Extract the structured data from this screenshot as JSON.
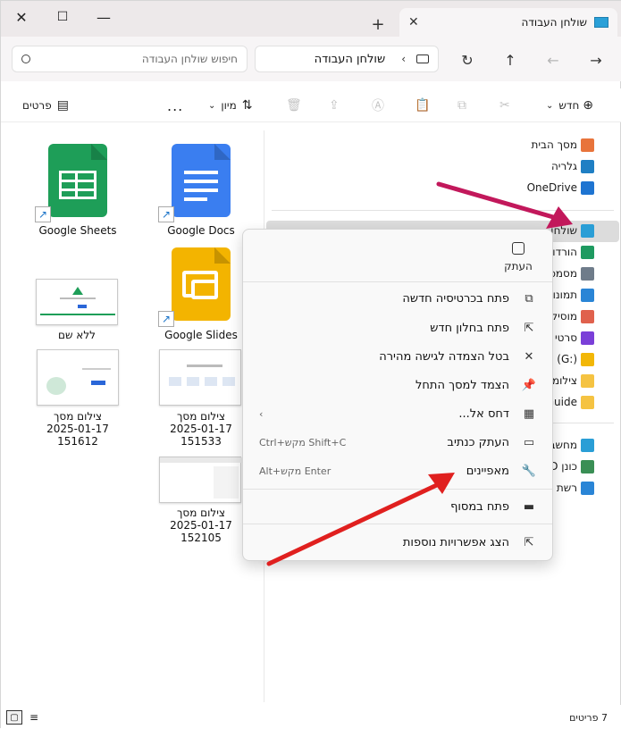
{
  "window": {
    "tab_title": "שולחן העבודה",
    "new_tab": "+",
    "close": "✕",
    "restore": "☐",
    "minimize": "—"
  },
  "address": {
    "crumb": "שולחן העבודה",
    "search_placeholder": "חיפוש שולחן העבודה"
  },
  "commands": {
    "new_label": "חדש",
    "sort_label": "מיון",
    "more_label": "...",
    "details_label": "פרטים"
  },
  "sidebar": {
    "items": [
      {
        "label": "מסך הבית",
        "icon": "home-icon",
        "color": "#e8743b"
      },
      {
        "label": "גלריה",
        "icon": "gallery-icon",
        "color": "#1f7fc4"
      },
      {
        "label": "OneDrive",
        "icon": "onedrive-cloud-icon",
        "color": "#1e74d1"
      },
      {
        "label": "שולחן",
        "icon": "desktop-icon",
        "color": "#2a9ed6"
      },
      {
        "label": "הורדו",
        "icon": "downloads-icon",
        "color": "#1e9a60"
      },
      {
        "label": "מסמכ",
        "icon": "documents-icon",
        "color": "#6f7c8a"
      },
      {
        "label": "תמונו",
        "icon": "pictures-icon",
        "color": "#2a85d6"
      },
      {
        "label": "מוסיק",
        "icon": "music-icon",
        "color": "#e0614d"
      },
      {
        "label": "סרטי",
        "icon": "videos-icon",
        "color": "#7a3fd8"
      },
      {
        "label": "e (G:)",
        "icon": "google-drive-icon",
        "color": "#f2b707"
      },
      {
        "label": "צילומ",
        "icon": "folder-icon",
        "color": "#f5c342"
      },
      {
        "label": "Guide",
        "icon": "folder-icon",
        "color": "#f5c342"
      },
      {
        "label": "מחשב",
        "icon": "this-pc-icon",
        "color": "#2a9ed6"
      },
      {
        "label": "כונן D",
        "icon": "drive-icon",
        "color": "#3a8f55"
      },
      {
        "label": "רשת",
        "icon": "network-icon",
        "color": "#2a85d6"
      }
    ]
  },
  "files": [
    {
      "label": "Google Sheets",
      "icon": "google-sheets-icon",
      "color": "#1e9e58"
    },
    {
      "label": "Google Docs",
      "icon": "google-docs-icon",
      "color": "#3a7ef0"
    },
    {
      "label": "ללא שם",
      "icon": "screenshot-thumbnail"
    },
    {
      "label": "Google Slides",
      "icon": "google-slides-icon",
      "color": "#f3b400"
    },
    {
      "label_lines": [
        "צילום מסך",
        "2025-01-17",
        "151612"
      ],
      "icon": "screenshot-thumbnail"
    },
    {
      "label_lines": [
        "צילום מסך",
        "2025-01-17",
        "151533"
      ],
      "icon": "screenshot-thumbnail"
    },
    {
      "label_lines": [
        "צילום מסך",
        "2025-01-17",
        "152105"
      ],
      "icon": "screenshot-thumbnail"
    }
  ],
  "context_menu": {
    "copy_label": "העתק",
    "items": [
      {
        "label": "פתח בכרטיסיה חדשה",
        "icon": "open-new-tab-icon",
        "shortcut": ""
      },
      {
        "label": "פתח בחלון חדש",
        "icon": "open-new-window-icon",
        "shortcut": ""
      },
      {
        "label": "בטל הצמדה לגישה מהירה",
        "icon": "unpin-icon",
        "shortcut": ""
      },
      {
        "label": "הצמד למסך התחל",
        "icon": "pin-icon",
        "shortcut": ""
      },
      {
        "label": "דחס אל...",
        "icon": "zip-icon",
        "shortcut": "‹"
      },
      {
        "label": "העתק כנתיב",
        "icon": "copy-path-icon",
        "shortcut": "Ctrl+מקש Shift+C"
      },
      {
        "label": "מאפיינים",
        "icon": "wrench-icon",
        "shortcut": "Alt+מקש Enter"
      },
      {
        "label": "פתח במסוף",
        "icon": "terminal-icon",
        "shortcut": ""
      },
      {
        "label": "הצג אפשרויות נוספות",
        "icon": "more-options-icon",
        "shortcut": ""
      }
    ]
  },
  "status": {
    "count": "7 פריטים"
  },
  "colors": {
    "arrow_magenta": "#c2185b",
    "arrow_red": "#e0201f"
  }
}
